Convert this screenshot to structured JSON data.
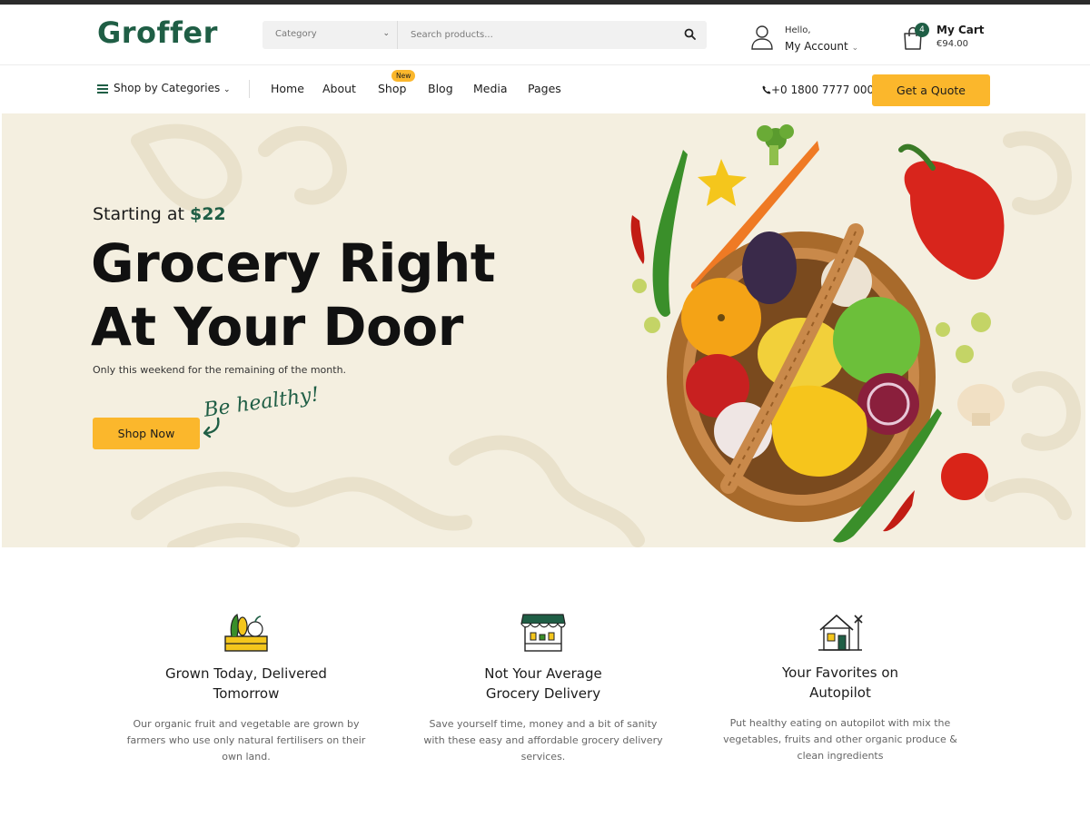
{
  "brand": {
    "logo": "Groffer",
    "green": "#1f5e45",
    "accent": "#fbb72c"
  },
  "search": {
    "category_label": "Category",
    "placeholder": "Search products..."
  },
  "account": {
    "hello": "Hello,",
    "label": "My Account"
  },
  "cart": {
    "count": "4",
    "label": "My Cart",
    "total": "€94.00"
  },
  "nav": {
    "categories_label": "Shop by Categories",
    "items": [
      {
        "label": "Home"
      },
      {
        "label": "About"
      },
      {
        "label": "Shop",
        "badge": "New"
      },
      {
        "label": "Blog"
      },
      {
        "label": "Media"
      },
      {
        "label": "Pages"
      }
    ],
    "phone": "+0 1800 7777 000",
    "quote_button": "Get a Quote"
  },
  "hero": {
    "starting_prefix": "Starting at",
    "starting_price": "$22",
    "title_line1": "Grocery Right",
    "title_line2": "At Your Door",
    "subtitle": "Only this weekend for the remaining of the month.",
    "script_text": "Be healthy!",
    "cta": "Shop Now"
  },
  "features": [
    {
      "icon": "produce-crate-icon",
      "title_line1": "Grown Today, Delivered",
      "title_line2": "Tomorrow",
      "desc_line1": "Our organic fruit and vegetable are grown by",
      "desc_line2": "farmers who use only natural fertilisers on their",
      "desc_line3": "own land."
    },
    {
      "icon": "market-stall-icon",
      "title_line1": "Not Your Average",
      "title_line2": "Grocery Delivery",
      "desc_line1": "Save yourself time, money and a bit of sanity",
      "desc_line2": "with these easy and affordable grocery delivery",
      "desc_line3": "services."
    },
    {
      "icon": "farmhouse-icon",
      "title_line1": "Your Favorites on",
      "title_line2": "Autopilot",
      "desc_line1": "Put healthy eating on autopilot with mix the",
      "desc_line2": "vegetables, fruits and other organic produce &",
      "desc_line3": "clean ingredients"
    }
  ]
}
